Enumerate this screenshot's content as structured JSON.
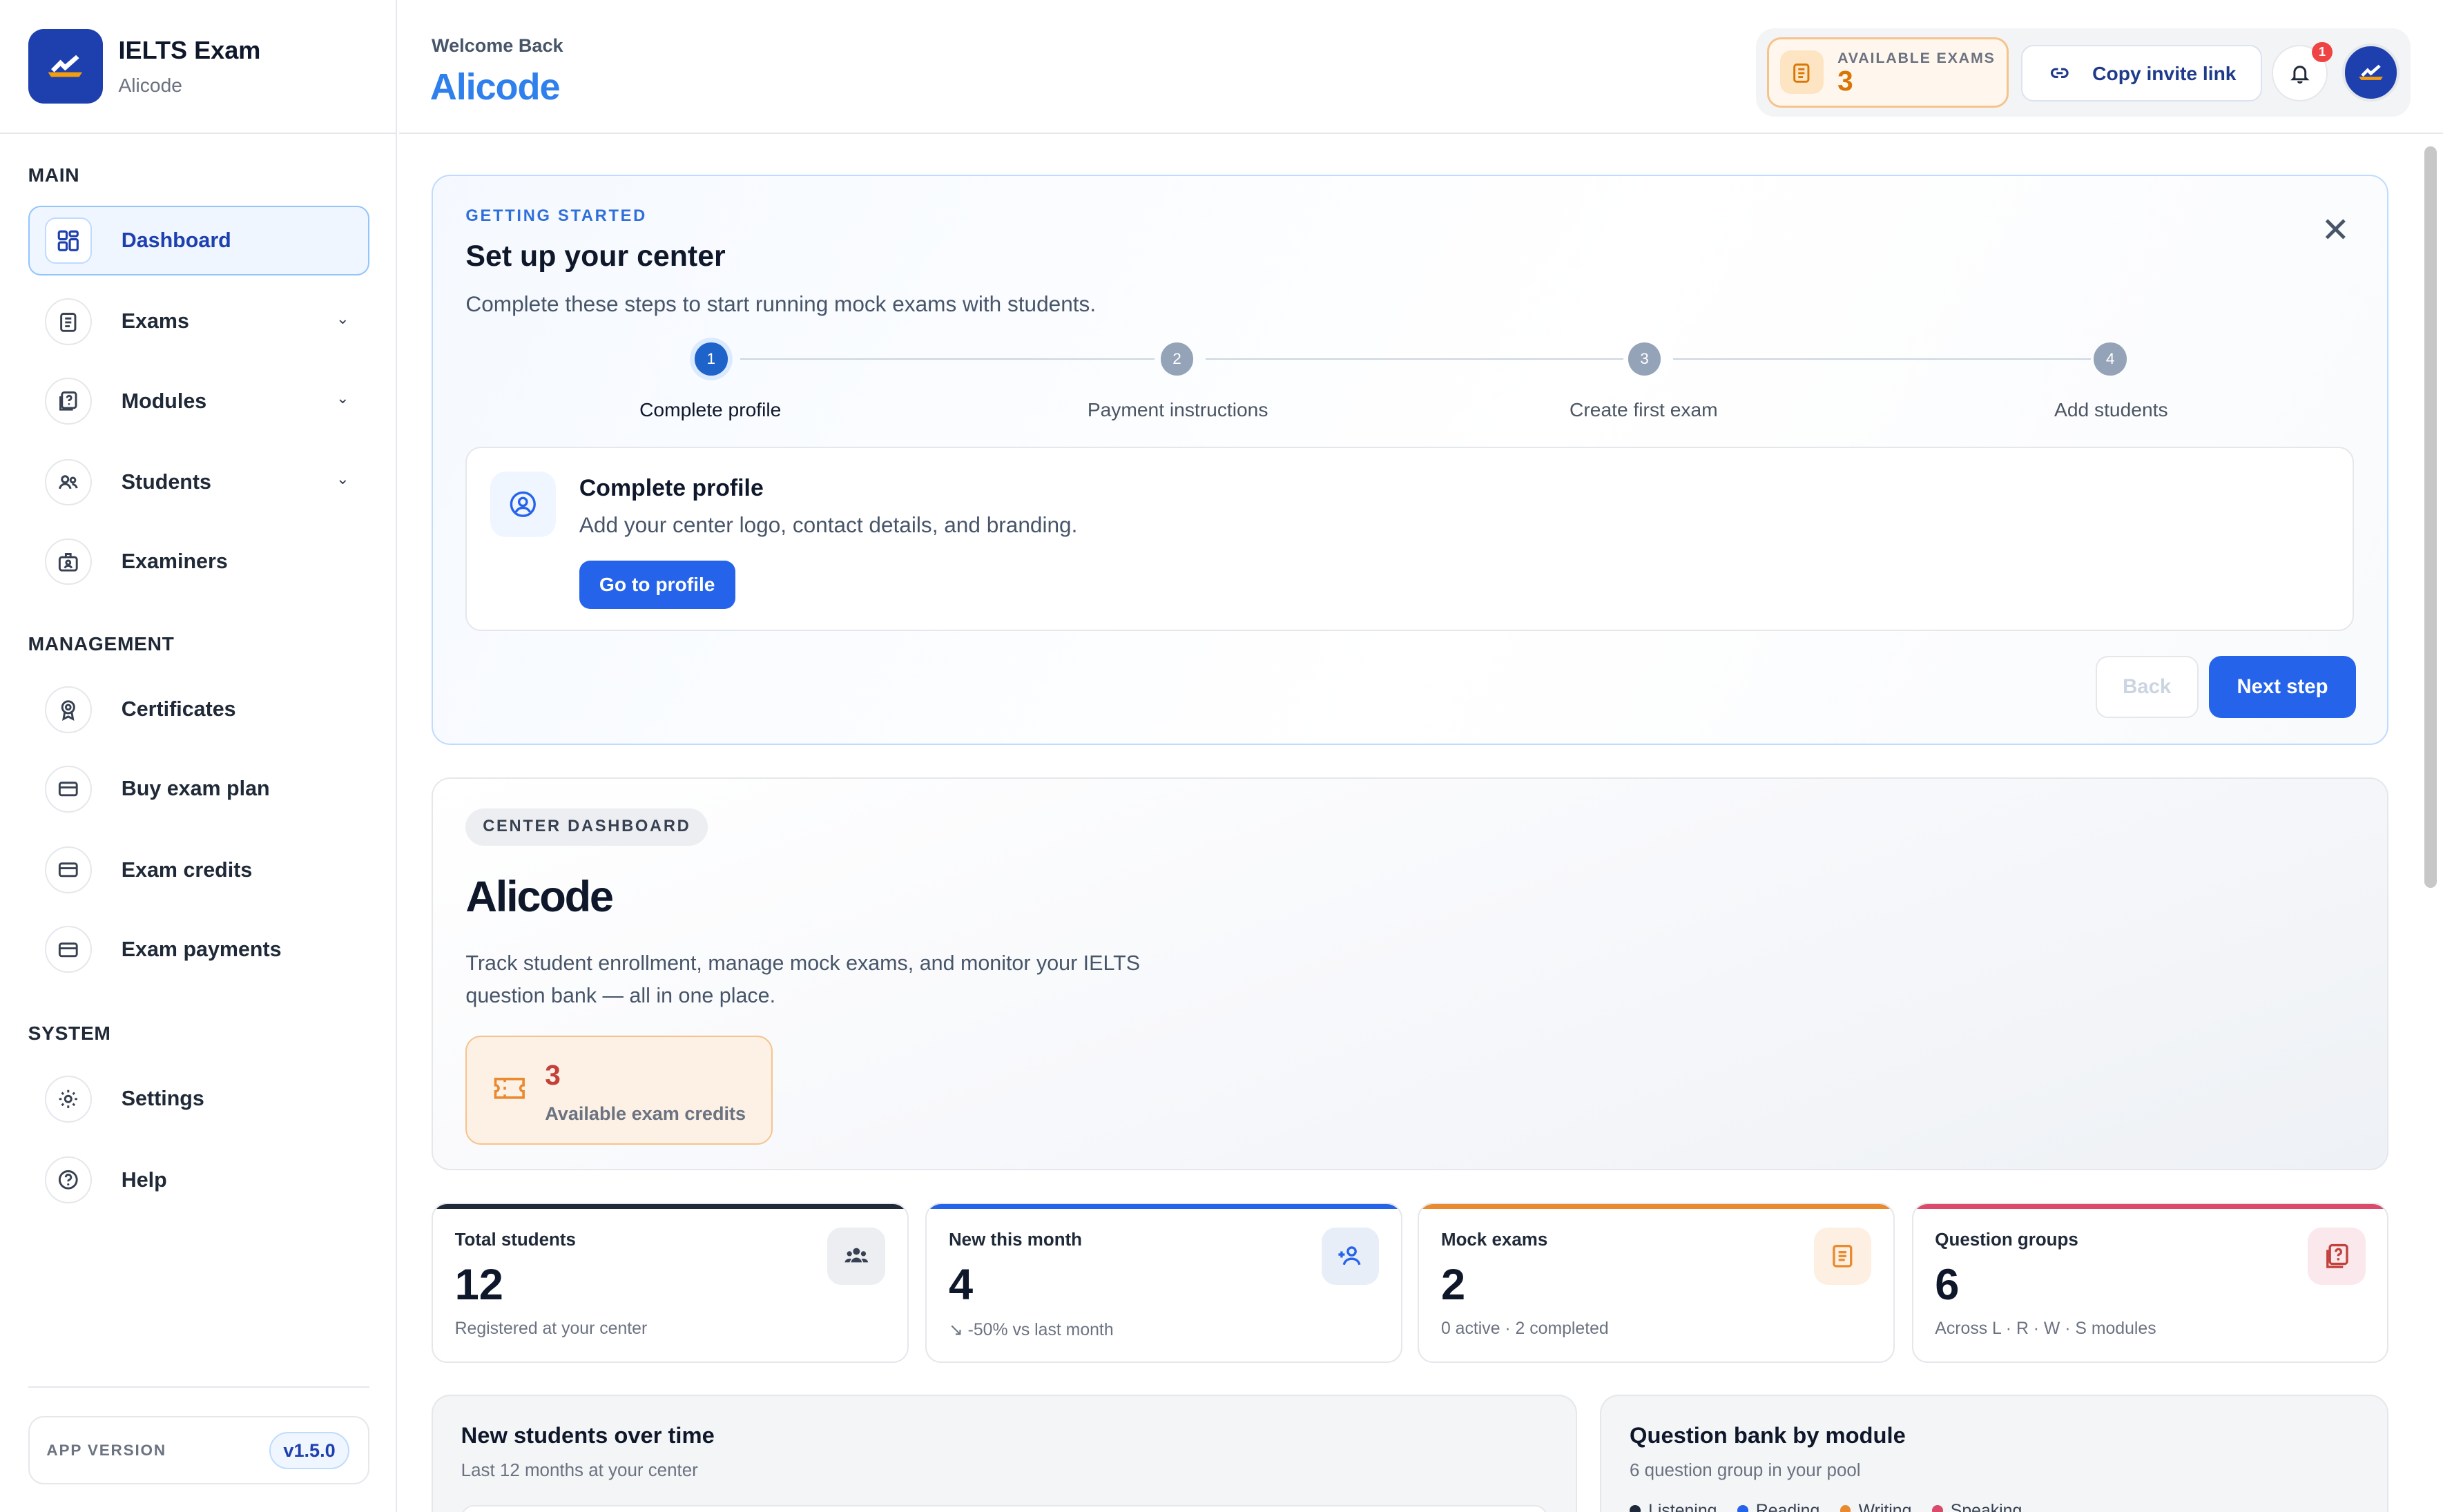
{
  "brand": {
    "title": "IELTS Exam",
    "subtitle": "Alicode"
  },
  "sidebar": {
    "sections": {
      "main": "MAIN",
      "management": "MANAGEMENT",
      "system": "SYSTEM"
    },
    "items": [
      {
        "label": "Dashboard",
        "icon": "grid-icon"
      },
      {
        "label": "Exams",
        "icon": "clipboard-icon"
      },
      {
        "label": "Modules",
        "icon": "question-book-icon"
      },
      {
        "label": "Students",
        "icon": "users-icon"
      },
      {
        "label": "Examiners",
        "icon": "id-badge-icon"
      },
      {
        "label": "Certificates",
        "icon": "award-icon"
      },
      {
        "label": "Buy exam plan",
        "icon": "card-icon"
      },
      {
        "label": "Exam credits",
        "icon": "card-icon"
      },
      {
        "label": "Exam payments",
        "icon": "card-icon"
      },
      {
        "label": "Settings",
        "icon": "gear-icon"
      },
      {
        "label": "Help",
        "icon": "help-icon"
      }
    ],
    "version_label": "APP VERSION",
    "version": "v1.5.0"
  },
  "header": {
    "welcome": "Welcome Back",
    "name": "Alicode",
    "available_label": "AVAILABLE EXAMS",
    "available_value": "3",
    "invite_label": "Copy invite link",
    "notification_count": "1"
  },
  "setup": {
    "eyebrow": "GETTING STARTED",
    "title": "Set up your center",
    "description": "Complete these steps to start running mock exams with students.",
    "steps": [
      {
        "num": "1",
        "label": "Complete profile"
      },
      {
        "num": "2",
        "label": "Payment instructions"
      },
      {
        "num": "3",
        "label": "Create first exam"
      },
      {
        "num": "4",
        "label": "Add students"
      }
    ],
    "panel": {
      "title": "Complete profile",
      "description": "Add your center logo, contact details, and branding.",
      "button": "Go to profile"
    },
    "back": "Back",
    "next": "Next step"
  },
  "dashboard": {
    "pill": "CENTER DASHBOARD",
    "name": "Alicode",
    "description": "Track student enrollment, manage mock exams, and monitor your IELTS question bank — all in one place.",
    "credits_value": "3",
    "credits_label": "Available exam credits"
  },
  "stats": [
    {
      "title": "Total students",
      "value": "12",
      "sub": "Registered at your center",
      "color": "#1f2937"
    },
    {
      "title": "New this month",
      "value": "4",
      "sub": "↘ -50% vs last month",
      "color": "#2563eb"
    },
    {
      "title": "Mock exams",
      "value": "2",
      "sub": "0 active · 2 completed",
      "color": "#ea8a2e"
    },
    {
      "title": "Question groups",
      "value": "6",
      "sub": "Across L · R · W · S modules",
      "color": "#db4a6b"
    }
  ],
  "charts": {
    "students": {
      "title": "New students over time",
      "sub": "Last 12 months at your center"
    },
    "bank": {
      "title": "Question bank by module",
      "sub": "6 question group in your pool",
      "legend": [
        {
          "label": "Listening",
          "color": "#1e293b"
        },
        {
          "label": "Reading",
          "color": "#2563eb"
        },
        {
          "label": "Writing",
          "color": "#ea8a2e"
        },
        {
          "label": "Speaking",
          "color": "#db4a6b"
        }
      ]
    }
  }
}
